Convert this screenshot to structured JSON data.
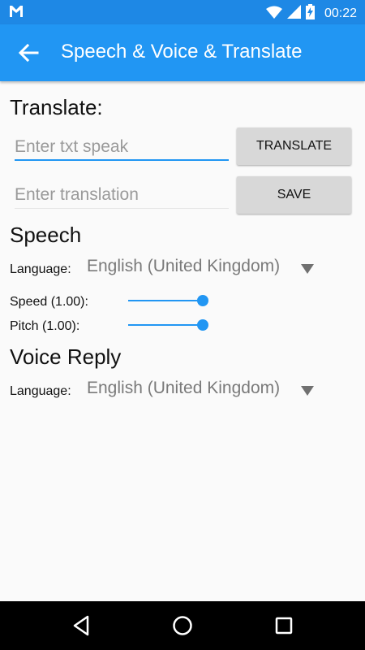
{
  "status_bar": {
    "time": "00:22",
    "icons": [
      "gmail-icon",
      "wifi-icon",
      "signal-icon",
      "battery-charging-icon"
    ],
    "color": "#1e88e5"
  },
  "app_bar": {
    "title": "Speech & Voice & Translate",
    "back_icon": "arrow-back-icon",
    "color": "#2196f3"
  },
  "translate": {
    "heading": "Translate:",
    "input_placeholder": "Enter txt speak",
    "translate_button": "TRANSLATE",
    "translation_placeholder": "Enter translation",
    "save_button": "SAVE"
  },
  "speech": {
    "heading": "Speech",
    "language_label": "Language:",
    "language_value": "English (United Kingdom)",
    "speed_label": "Speed (1.00):",
    "speed_level": 1.0,
    "pitch_label": "Pitch (1.00):",
    "pitch_level": 1.0
  },
  "voice_reply": {
    "heading": "Voice Reply",
    "language_label": "Language:",
    "language_value": "English (United Kingdom)"
  },
  "nav_bar": {
    "icons": [
      "back-triangle-icon",
      "home-circle-icon",
      "recents-square-icon"
    ]
  },
  "accent_color": "#2196f3"
}
